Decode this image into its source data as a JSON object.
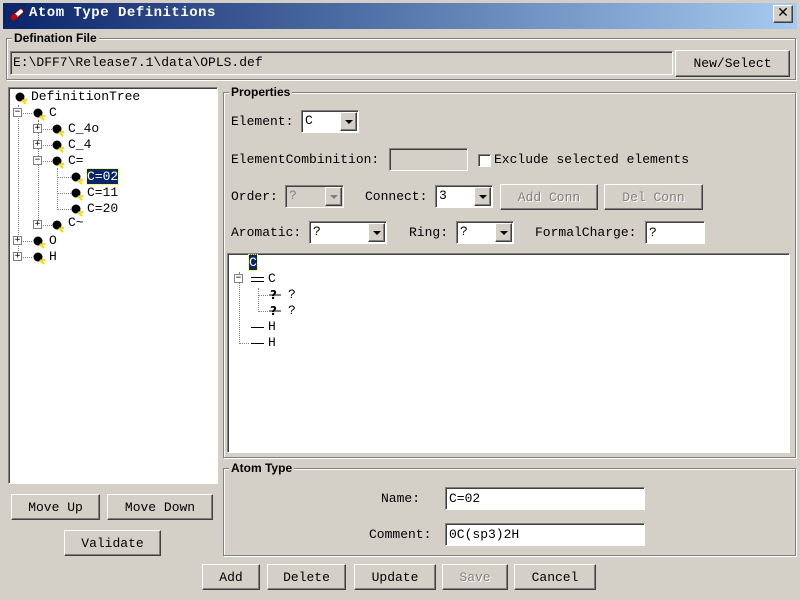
{
  "window": {
    "title": "Atom Type Definitions",
    "close_glyph": "✕"
  },
  "definition_file": {
    "group_label": "Defination File",
    "path": "E:\\DFF7\\Release7.1\\data\\OPLS.def",
    "new_select_label": "New/Select"
  },
  "tree": {
    "root": "DefinitionTree",
    "nodes": {
      "c": "C",
      "c_4o": "C_4o",
      "c_4": "C_4",
      "c_eq": "C=",
      "c_eq_02": "C=02",
      "c_eq_11": "C=11",
      "c_eq_20": "C=20",
      "c_tilde": "C~",
      "o": "O",
      "h": "H"
    },
    "expand_glyph": "+",
    "collapse_glyph": "−"
  },
  "left_buttons": {
    "move_up": "Move Up",
    "move_down": "Move Down",
    "validate": "Validate"
  },
  "properties": {
    "group_label": "Properties",
    "element_label": "Element:",
    "element_value": "C",
    "elementcombination_label": "ElementCombinition:",
    "exclude_label": "Exclude selected elements",
    "order_label": "Order:",
    "order_value": "?",
    "connect_label": "Connect:",
    "connect_value": "3",
    "add_conn": "Add Conn",
    "del_conn": "Del Conn",
    "aromatic_label": "Aromatic:",
    "aromatic_value": "?",
    "ring_label": "Ring:",
    "ring_value": "?",
    "formalcharge_label": "FormalCharge:",
    "formalcharge_value": "?"
  },
  "structure_tree": {
    "root": "C",
    "child_c": "C",
    "q1": "?",
    "q2": "?",
    "h1": "H",
    "h2": "H"
  },
  "atom_type": {
    "group_label": "Atom Type",
    "name_label": "Name:",
    "name_value": "C=02",
    "comment_label": "Comment:",
    "comment_value": "0C(sp3)2H"
  },
  "bottom_buttons": {
    "add": "Add",
    "delete": "Delete",
    "update": "Update",
    "save": "Save",
    "cancel": "Cancel"
  },
  "colors": {
    "titlebar_start": "#0a246a",
    "titlebar_end": "#a6caf0",
    "face": "#d4d0c8",
    "selection": "#0a246a"
  }
}
